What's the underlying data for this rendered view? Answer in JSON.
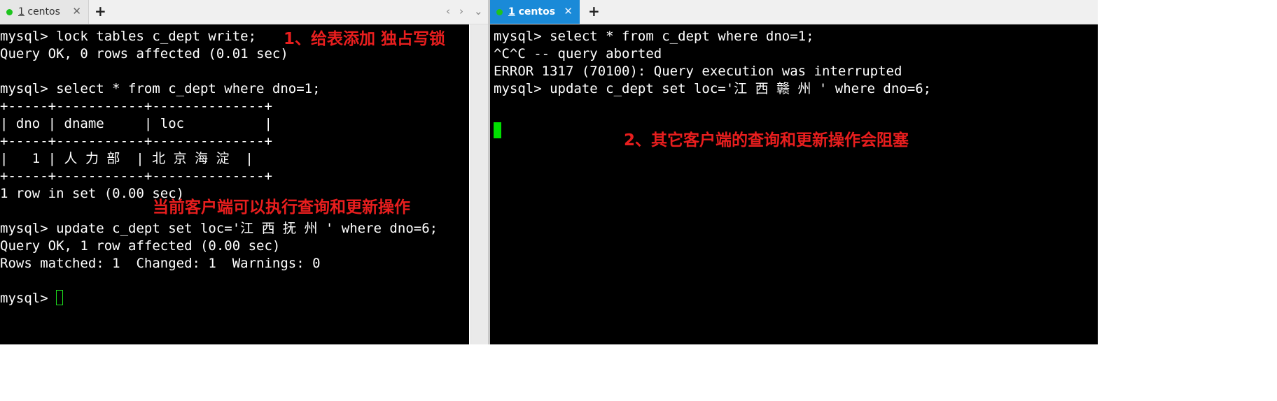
{
  "left_pane": {
    "tab": {
      "number": "1",
      "title": " centos",
      "close": "✕"
    },
    "add_tab": "+",
    "nav": {
      "prev": "‹",
      "next": "›",
      "menu": "⌄"
    },
    "lines": [
      "mysql> lock tables c_dept write;",
      "Query OK, 0 rows affected (0.01 sec)",
      "",
      "mysql> select * from c_dept where dno=1;",
      "+-----+-----------+--------------+",
      "| dno | dname     | loc          |",
      "+-----+-----------+--------------+",
      "|   1 | 人 力 部  | 北 京 海 淀  |",
      "+-----+-----------+--------------+",
      "1 row in set (0.00 sec)",
      "",
      "mysql> update c_dept set loc='江 西 抚 州 ' where dno=6;",
      "Query OK, 1 row affected (0.00 sec)",
      "Rows matched: 1  Changed: 1  Warnings: 0",
      "",
      "mysql> "
    ],
    "annotations": {
      "lock_note": "1、给表添加 独占写锁",
      "client_note": "当前客户端可以执行查询和更新操作"
    }
  },
  "right_pane": {
    "tab": {
      "number": "1",
      "title": " centos",
      "close": "✕"
    },
    "add_tab": "+",
    "lines": [
      "mysql> select * from c_dept where dno=1;",
      "^C^C -- query aborted",
      "ERROR 1317 (70100): Query execution was interrupted",
      "mysql> update c_dept set loc='江 西 赣 州 ' where dno=6;"
    ],
    "annotations": {
      "blocked_note": "2、其它客户端的查询和更新操作会阻塞"
    }
  },
  "colors": {
    "terminal_bg": "#000000",
    "terminal_text": "#ffffff",
    "annotation": "#e81e1e",
    "active_tab": "#1a8ad8",
    "cursor": "#00e000",
    "status_dot": "#1ec41e"
  }
}
